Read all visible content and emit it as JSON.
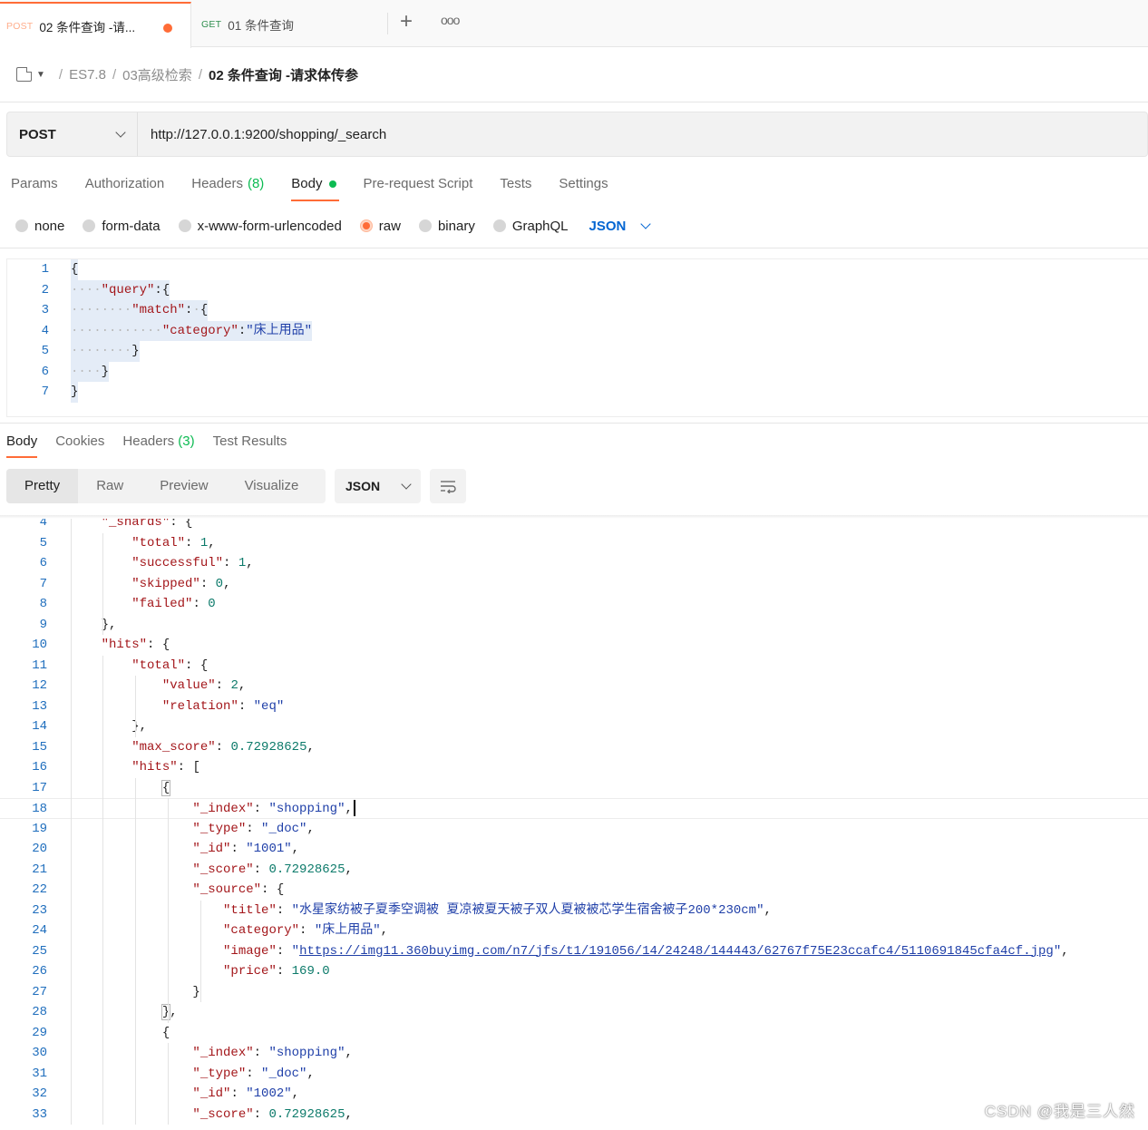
{
  "tabs": [
    {
      "method": "POST",
      "title": "02 条件查询 -请..."
    },
    {
      "method": "GET",
      "title": "01 条件查询"
    }
  ],
  "breadcrumb": {
    "items": [
      "ES7.8",
      "03高级检索"
    ],
    "current": "02 条件查询 -请求体传参"
  },
  "request": {
    "method": "POST",
    "url": "http://127.0.0.1:9200/shopping/_search"
  },
  "request_tabs": [
    {
      "label": "Params"
    },
    {
      "label": "Authorization"
    },
    {
      "label": "Headers",
      "count": "(8)"
    },
    {
      "label": "Body",
      "active": true
    },
    {
      "label": "Pre-request Script"
    },
    {
      "label": "Tests"
    },
    {
      "label": "Settings"
    }
  ],
  "body_types": [
    "none",
    "form-data",
    "x-www-form-urlencoded",
    "raw",
    "binary",
    "GraphQL"
  ],
  "body_type_selected": "raw",
  "body_language": "JSON",
  "request_body_lines": [
    {
      "n": "1",
      "text": "{"
    },
    {
      "n": "2",
      "text": "····\"query\":{"
    },
    {
      "n": "3",
      "text": "········\"match\":·{"
    },
    {
      "n": "4",
      "text": "············\"category\":\"床上用品\""
    },
    {
      "n": "5",
      "text": "········}"
    },
    {
      "n": "6",
      "text": "····}"
    },
    {
      "n": "7",
      "text": "}"
    }
  ],
  "response_tabs": [
    {
      "label": "Body",
      "active": true
    },
    {
      "label": "Cookies"
    },
    {
      "label": "Headers",
      "count": "(3)"
    },
    {
      "label": "Test Results"
    }
  ],
  "response_views": [
    "Pretty",
    "Raw",
    "Preview",
    "Visualize"
  ],
  "response_format": "JSON",
  "response_lines": [
    {
      "n": "4",
      "text": "    \"_shards\": {"
    },
    {
      "n": "5",
      "text": "        \"total\": 1,"
    },
    {
      "n": "6",
      "text": "        \"successful\": 1,"
    },
    {
      "n": "7",
      "text": "        \"skipped\": 0,"
    },
    {
      "n": "8",
      "text": "        \"failed\": 0"
    },
    {
      "n": "9",
      "text": "    },"
    },
    {
      "n": "10",
      "text": "    \"hits\": {"
    },
    {
      "n": "11",
      "text": "        \"total\": {"
    },
    {
      "n": "12",
      "text": "            \"value\": 2,"
    },
    {
      "n": "13",
      "text": "            \"relation\": \"eq\""
    },
    {
      "n": "14",
      "text": "        },"
    },
    {
      "n": "15",
      "text": "        \"max_score\": 0.72928625,"
    },
    {
      "n": "16",
      "text": "        \"hits\": ["
    },
    {
      "n": "17",
      "text": "            {"
    },
    {
      "n": "18",
      "text": "                \"_index\": \"shopping\","
    },
    {
      "n": "19",
      "text": "                \"_type\": \"_doc\","
    },
    {
      "n": "20",
      "text": "                \"_id\": \"1001\","
    },
    {
      "n": "21",
      "text": "                \"_score\": 0.72928625,"
    },
    {
      "n": "22",
      "text": "                \"_source\": {"
    },
    {
      "n": "23",
      "text": "                    \"title\": \"水星家纺被子夏季空调被 夏凉被夏天被子双人夏被被芯学生宿舍被子200*230cm\","
    },
    {
      "n": "24",
      "text": "                    \"category\": \"床上用品\","
    },
    {
      "n": "25",
      "text": "                    \"image\": \"https://img11.360buyimg.com/n7/jfs/t1/191056/14/24248/144443/62767f75E23ccafc4/5110691845cfa4cf.jpg\","
    },
    {
      "n": "26",
      "text": "                    \"price\": 169.0"
    },
    {
      "n": "27",
      "text": "                }"
    },
    {
      "n": "28",
      "text": "            },"
    },
    {
      "n": "29",
      "text": "            {"
    },
    {
      "n": "30",
      "text": "                \"_index\": \"shopping\","
    },
    {
      "n": "31",
      "text": "                \"_type\": \"_doc\","
    },
    {
      "n": "32",
      "text": "                \"_id\": \"1002\","
    },
    {
      "n": "33",
      "text": "                \"_score\": 0.72928625,"
    }
  ],
  "watermark": "CSDN @我是三人然",
  "colors": {
    "accent": "#ff6c37",
    "green": "#0cbb52",
    "blue": "#0265d2",
    "json_key": "#a3161a",
    "json_string": "#1f3fa8",
    "json_number": "#0c7a6a"
  }
}
